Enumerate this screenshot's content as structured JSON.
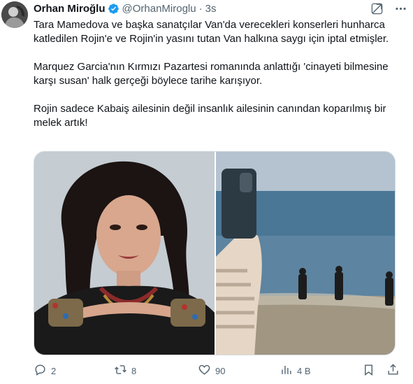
{
  "author": {
    "display_name": "Orhan Miroğlu",
    "handle": "@OrhanMiroglu",
    "separator": "·",
    "time": "3s",
    "verified": true,
    "avatar_icon": "profile-photo"
  },
  "header_actions": {
    "grok_icon": "grok-icon",
    "more_icon": "more-icon"
  },
  "tweet": {
    "paragraphs": [
      "Tara Mamedova ve başka sanatçılar Van'da verecekleri konserleri hunharca katledilen Rojin'e ve Rojin'in yasını tutan Van halkına saygı için iptal etmişler.",
      "Marquez Garcia'nın Kırmızı Pazartesi romanında anlattığı 'cinayeti bilmesine karşı susan' halk gerçeği böylece tarihe karışıyor.",
      "Rojin sadece Kabaiş ailesinin değil insanlık ailesinin canından koparılmış bir melek artık!"
    ]
  },
  "media": {
    "images": [
      {
        "name": "singer-portrait-photo"
      },
      {
        "name": "lake-shore-divers-photo"
      }
    ]
  },
  "actions": {
    "reply_count": "2",
    "retweet_count": "8",
    "like_count": "90",
    "views_count": "4 B",
    "icons": [
      "reply-icon",
      "retweet-icon",
      "like-icon",
      "views-icon",
      "bookmark-icon",
      "share-icon"
    ]
  },
  "colors": {
    "verified": "#1d9bf0",
    "text": "#0f1419",
    "secondary": "#536471",
    "border": "#cfd9de"
  }
}
